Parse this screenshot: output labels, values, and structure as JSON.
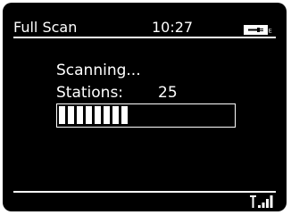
{
  "header": {
    "title": "Full Scan",
    "time": "10:27",
    "battery_icon": "battery-plug-icon",
    "battery_mark": "E"
  },
  "scan": {
    "status": "Scanning...",
    "stations_label": "Stations:",
    "stations_count": "25",
    "progress_fraction": 0.4
  },
  "footer": {
    "signal_icon": "signal-strength-icon"
  }
}
